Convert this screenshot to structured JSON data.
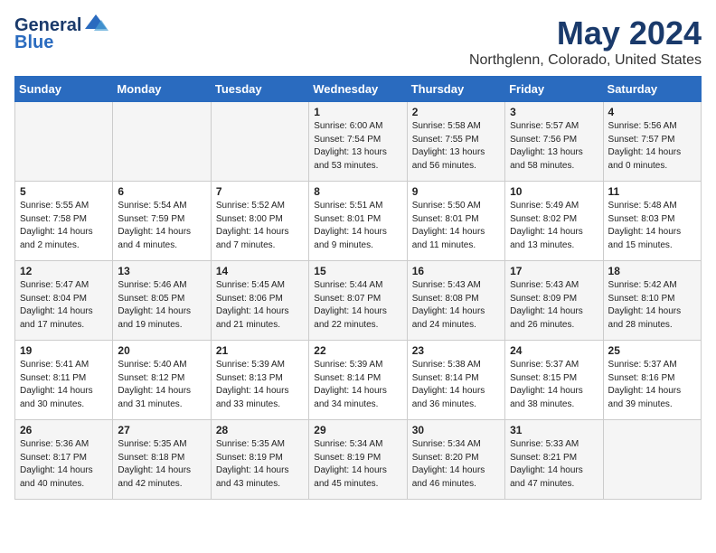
{
  "logo": {
    "line1": "General",
    "line2": "Blue"
  },
  "title": "May 2024",
  "subtitle": "Northglenn, Colorado, United States",
  "days_of_week": [
    "Sunday",
    "Monday",
    "Tuesday",
    "Wednesday",
    "Thursday",
    "Friday",
    "Saturday"
  ],
  "weeks": [
    [
      {
        "day": "",
        "info": ""
      },
      {
        "day": "",
        "info": ""
      },
      {
        "day": "",
        "info": ""
      },
      {
        "day": "1",
        "info": "Sunrise: 6:00 AM\nSunset: 7:54 PM\nDaylight: 13 hours\nand 53 minutes."
      },
      {
        "day": "2",
        "info": "Sunrise: 5:58 AM\nSunset: 7:55 PM\nDaylight: 13 hours\nand 56 minutes."
      },
      {
        "day": "3",
        "info": "Sunrise: 5:57 AM\nSunset: 7:56 PM\nDaylight: 13 hours\nand 58 minutes."
      },
      {
        "day": "4",
        "info": "Sunrise: 5:56 AM\nSunset: 7:57 PM\nDaylight: 14 hours\nand 0 minutes."
      }
    ],
    [
      {
        "day": "5",
        "info": "Sunrise: 5:55 AM\nSunset: 7:58 PM\nDaylight: 14 hours\nand 2 minutes."
      },
      {
        "day": "6",
        "info": "Sunrise: 5:54 AM\nSunset: 7:59 PM\nDaylight: 14 hours\nand 4 minutes."
      },
      {
        "day": "7",
        "info": "Sunrise: 5:52 AM\nSunset: 8:00 PM\nDaylight: 14 hours\nand 7 minutes."
      },
      {
        "day": "8",
        "info": "Sunrise: 5:51 AM\nSunset: 8:01 PM\nDaylight: 14 hours\nand 9 minutes."
      },
      {
        "day": "9",
        "info": "Sunrise: 5:50 AM\nSunset: 8:01 PM\nDaylight: 14 hours\nand 11 minutes."
      },
      {
        "day": "10",
        "info": "Sunrise: 5:49 AM\nSunset: 8:02 PM\nDaylight: 14 hours\nand 13 minutes."
      },
      {
        "day": "11",
        "info": "Sunrise: 5:48 AM\nSunset: 8:03 PM\nDaylight: 14 hours\nand 15 minutes."
      }
    ],
    [
      {
        "day": "12",
        "info": "Sunrise: 5:47 AM\nSunset: 8:04 PM\nDaylight: 14 hours\nand 17 minutes."
      },
      {
        "day": "13",
        "info": "Sunrise: 5:46 AM\nSunset: 8:05 PM\nDaylight: 14 hours\nand 19 minutes."
      },
      {
        "day": "14",
        "info": "Sunrise: 5:45 AM\nSunset: 8:06 PM\nDaylight: 14 hours\nand 21 minutes."
      },
      {
        "day": "15",
        "info": "Sunrise: 5:44 AM\nSunset: 8:07 PM\nDaylight: 14 hours\nand 22 minutes."
      },
      {
        "day": "16",
        "info": "Sunrise: 5:43 AM\nSunset: 8:08 PM\nDaylight: 14 hours\nand 24 minutes."
      },
      {
        "day": "17",
        "info": "Sunrise: 5:43 AM\nSunset: 8:09 PM\nDaylight: 14 hours\nand 26 minutes."
      },
      {
        "day": "18",
        "info": "Sunrise: 5:42 AM\nSunset: 8:10 PM\nDaylight: 14 hours\nand 28 minutes."
      }
    ],
    [
      {
        "day": "19",
        "info": "Sunrise: 5:41 AM\nSunset: 8:11 PM\nDaylight: 14 hours\nand 30 minutes."
      },
      {
        "day": "20",
        "info": "Sunrise: 5:40 AM\nSunset: 8:12 PM\nDaylight: 14 hours\nand 31 minutes."
      },
      {
        "day": "21",
        "info": "Sunrise: 5:39 AM\nSunset: 8:13 PM\nDaylight: 14 hours\nand 33 minutes."
      },
      {
        "day": "22",
        "info": "Sunrise: 5:39 AM\nSunset: 8:14 PM\nDaylight: 14 hours\nand 34 minutes."
      },
      {
        "day": "23",
        "info": "Sunrise: 5:38 AM\nSunset: 8:14 PM\nDaylight: 14 hours\nand 36 minutes."
      },
      {
        "day": "24",
        "info": "Sunrise: 5:37 AM\nSunset: 8:15 PM\nDaylight: 14 hours\nand 38 minutes."
      },
      {
        "day": "25",
        "info": "Sunrise: 5:37 AM\nSunset: 8:16 PM\nDaylight: 14 hours\nand 39 minutes."
      }
    ],
    [
      {
        "day": "26",
        "info": "Sunrise: 5:36 AM\nSunset: 8:17 PM\nDaylight: 14 hours\nand 40 minutes."
      },
      {
        "day": "27",
        "info": "Sunrise: 5:35 AM\nSunset: 8:18 PM\nDaylight: 14 hours\nand 42 minutes."
      },
      {
        "day": "28",
        "info": "Sunrise: 5:35 AM\nSunset: 8:19 PM\nDaylight: 14 hours\nand 43 minutes."
      },
      {
        "day": "29",
        "info": "Sunrise: 5:34 AM\nSunset: 8:19 PM\nDaylight: 14 hours\nand 45 minutes."
      },
      {
        "day": "30",
        "info": "Sunrise: 5:34 AM\nSunset: 8:20 PM\nDaylight: 14 hours\nand 46 minutes."
      },
      {
        "day": "31",
        "info": "Sunrise: 5:33 AM\nSunset: 8:21 PM\nDaylight: 14 hours\nand 47 minutes."
      },
      {
        "day": "",
        "info": ""
      }
    ]
  ]
}
